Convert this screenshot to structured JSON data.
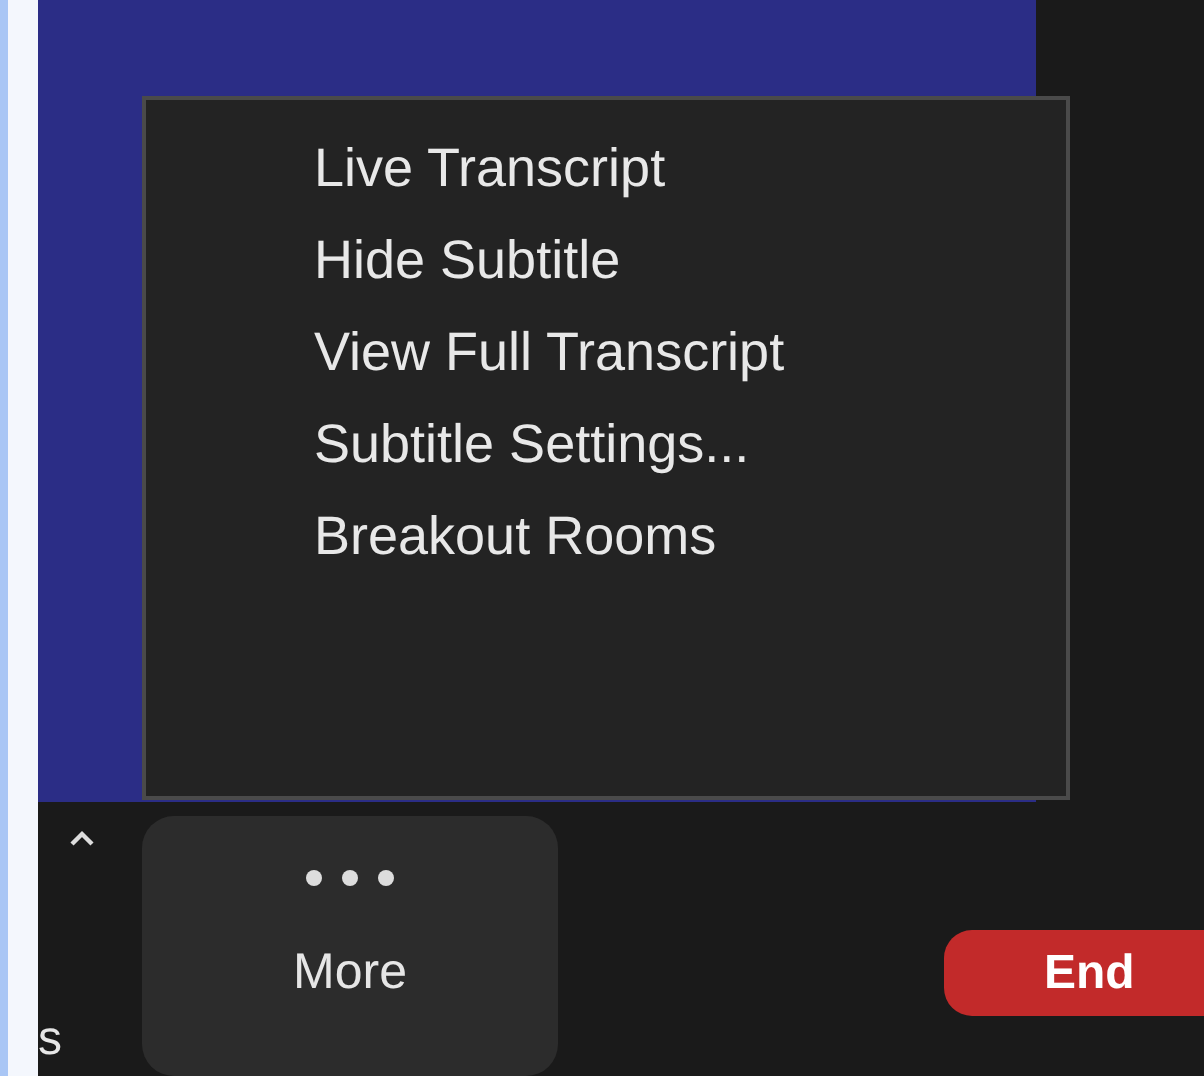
{
  "menu": {
    "items": [
      {
        "label": "Live Transcript"
      },
      {
        "label": "Hide Subtitle"
      },
      {
        "label": "View Full Transcript"
      },
      {
        "label": "Subtitle Settings..."
      },
      {
        "label": "Breakout Rooms"
      }
    ]
  },
  "toolbar": {
    "partial_label": "s",
    "more_label": "More",
    "end_label": "End"
  }
}
